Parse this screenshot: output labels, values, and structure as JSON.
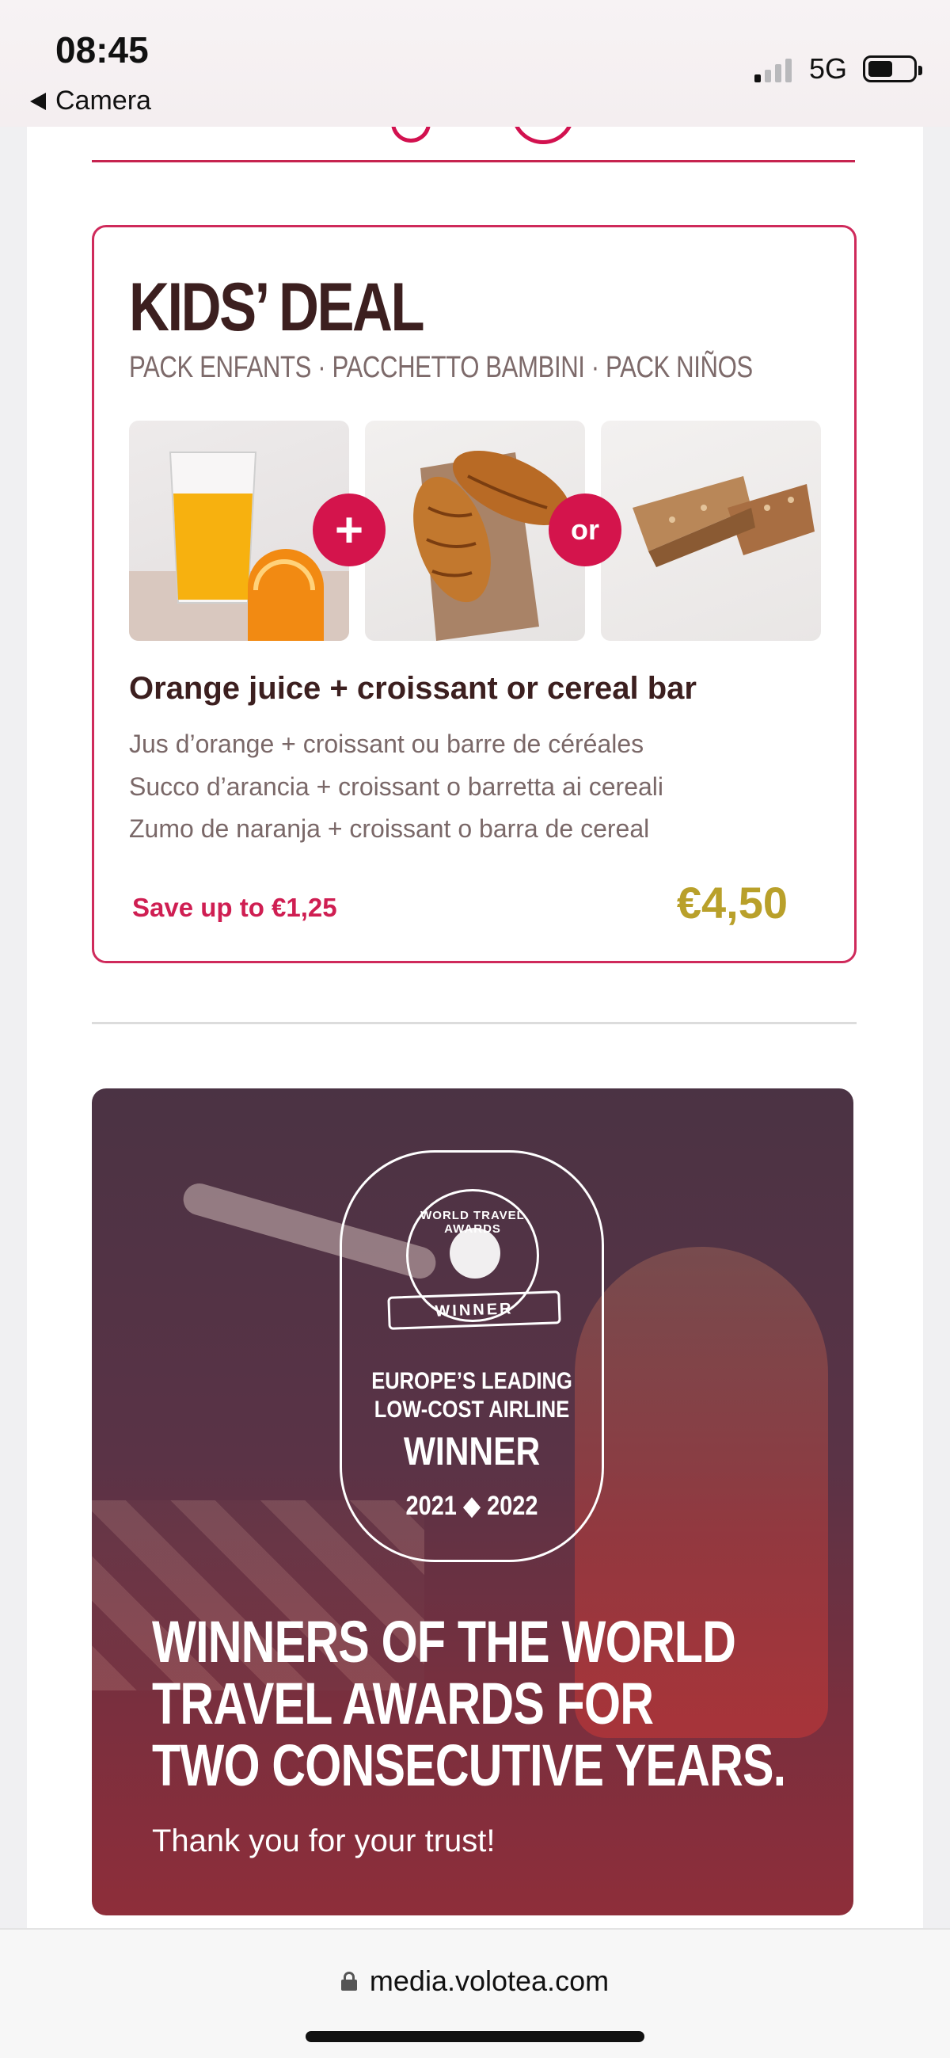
{
  "status_bar": {
    "time": "08:45",
    "back_label": "Camera",
    "network": "5G",
    "battery_level": 0.55
  },
  "kids_deal": {
    "title": "KIDS’ DEAL",
    "subtitle": "PACK ENFANTS · PACCHETTO BAMBINI · PACK NIÑOS",
    "images": [
      "orange-juice-photo",
      "croissant-photo",
      "cereal-bar-photo"
    ],
    "connector_plus": "+",
    "connector_or": "or",
    "heading": "Orange juice + croissant or cereal bar",
    "translations": [
      "Jus d’orange + croissant ou barre de céréales",
      "Succo d’arancia + croissant o barretta ai cereali",
      "Zumo de naranja + croissant o barra de cereal"
    ],
    "save_text": "Save up to €1,25",
    "price": "€4,50"
  },
  "award": {
    "seal_text": "WORLD TRAVEL AWARDS",
    "ribbon_text": "WINNER",
    "badge_line1": "EUROPE’S LEADING",
    "badge_line2": "LOW-COST AIRLINE",
    "badge_winner": "WINNER",
    "badge_years": "2021 ◆ 2022",
    "headline": [
      "WINNERS OF THE WORLD",
      "TRAVEL AWARDS FOR",
      "TWO CONSECUTIVE YEARS."
    ],
    "thanks": "Thank you for your trust!"
  },
  "browser": {
    "url": "media.volotea.com"
  },
  "colors": {
    "brand_pink": "#d4144c",
    "title_brown": "#3c1f1f",
    "price_gold": "#b9a02a",
    "award_bg": "#5a3346"
  }
}
